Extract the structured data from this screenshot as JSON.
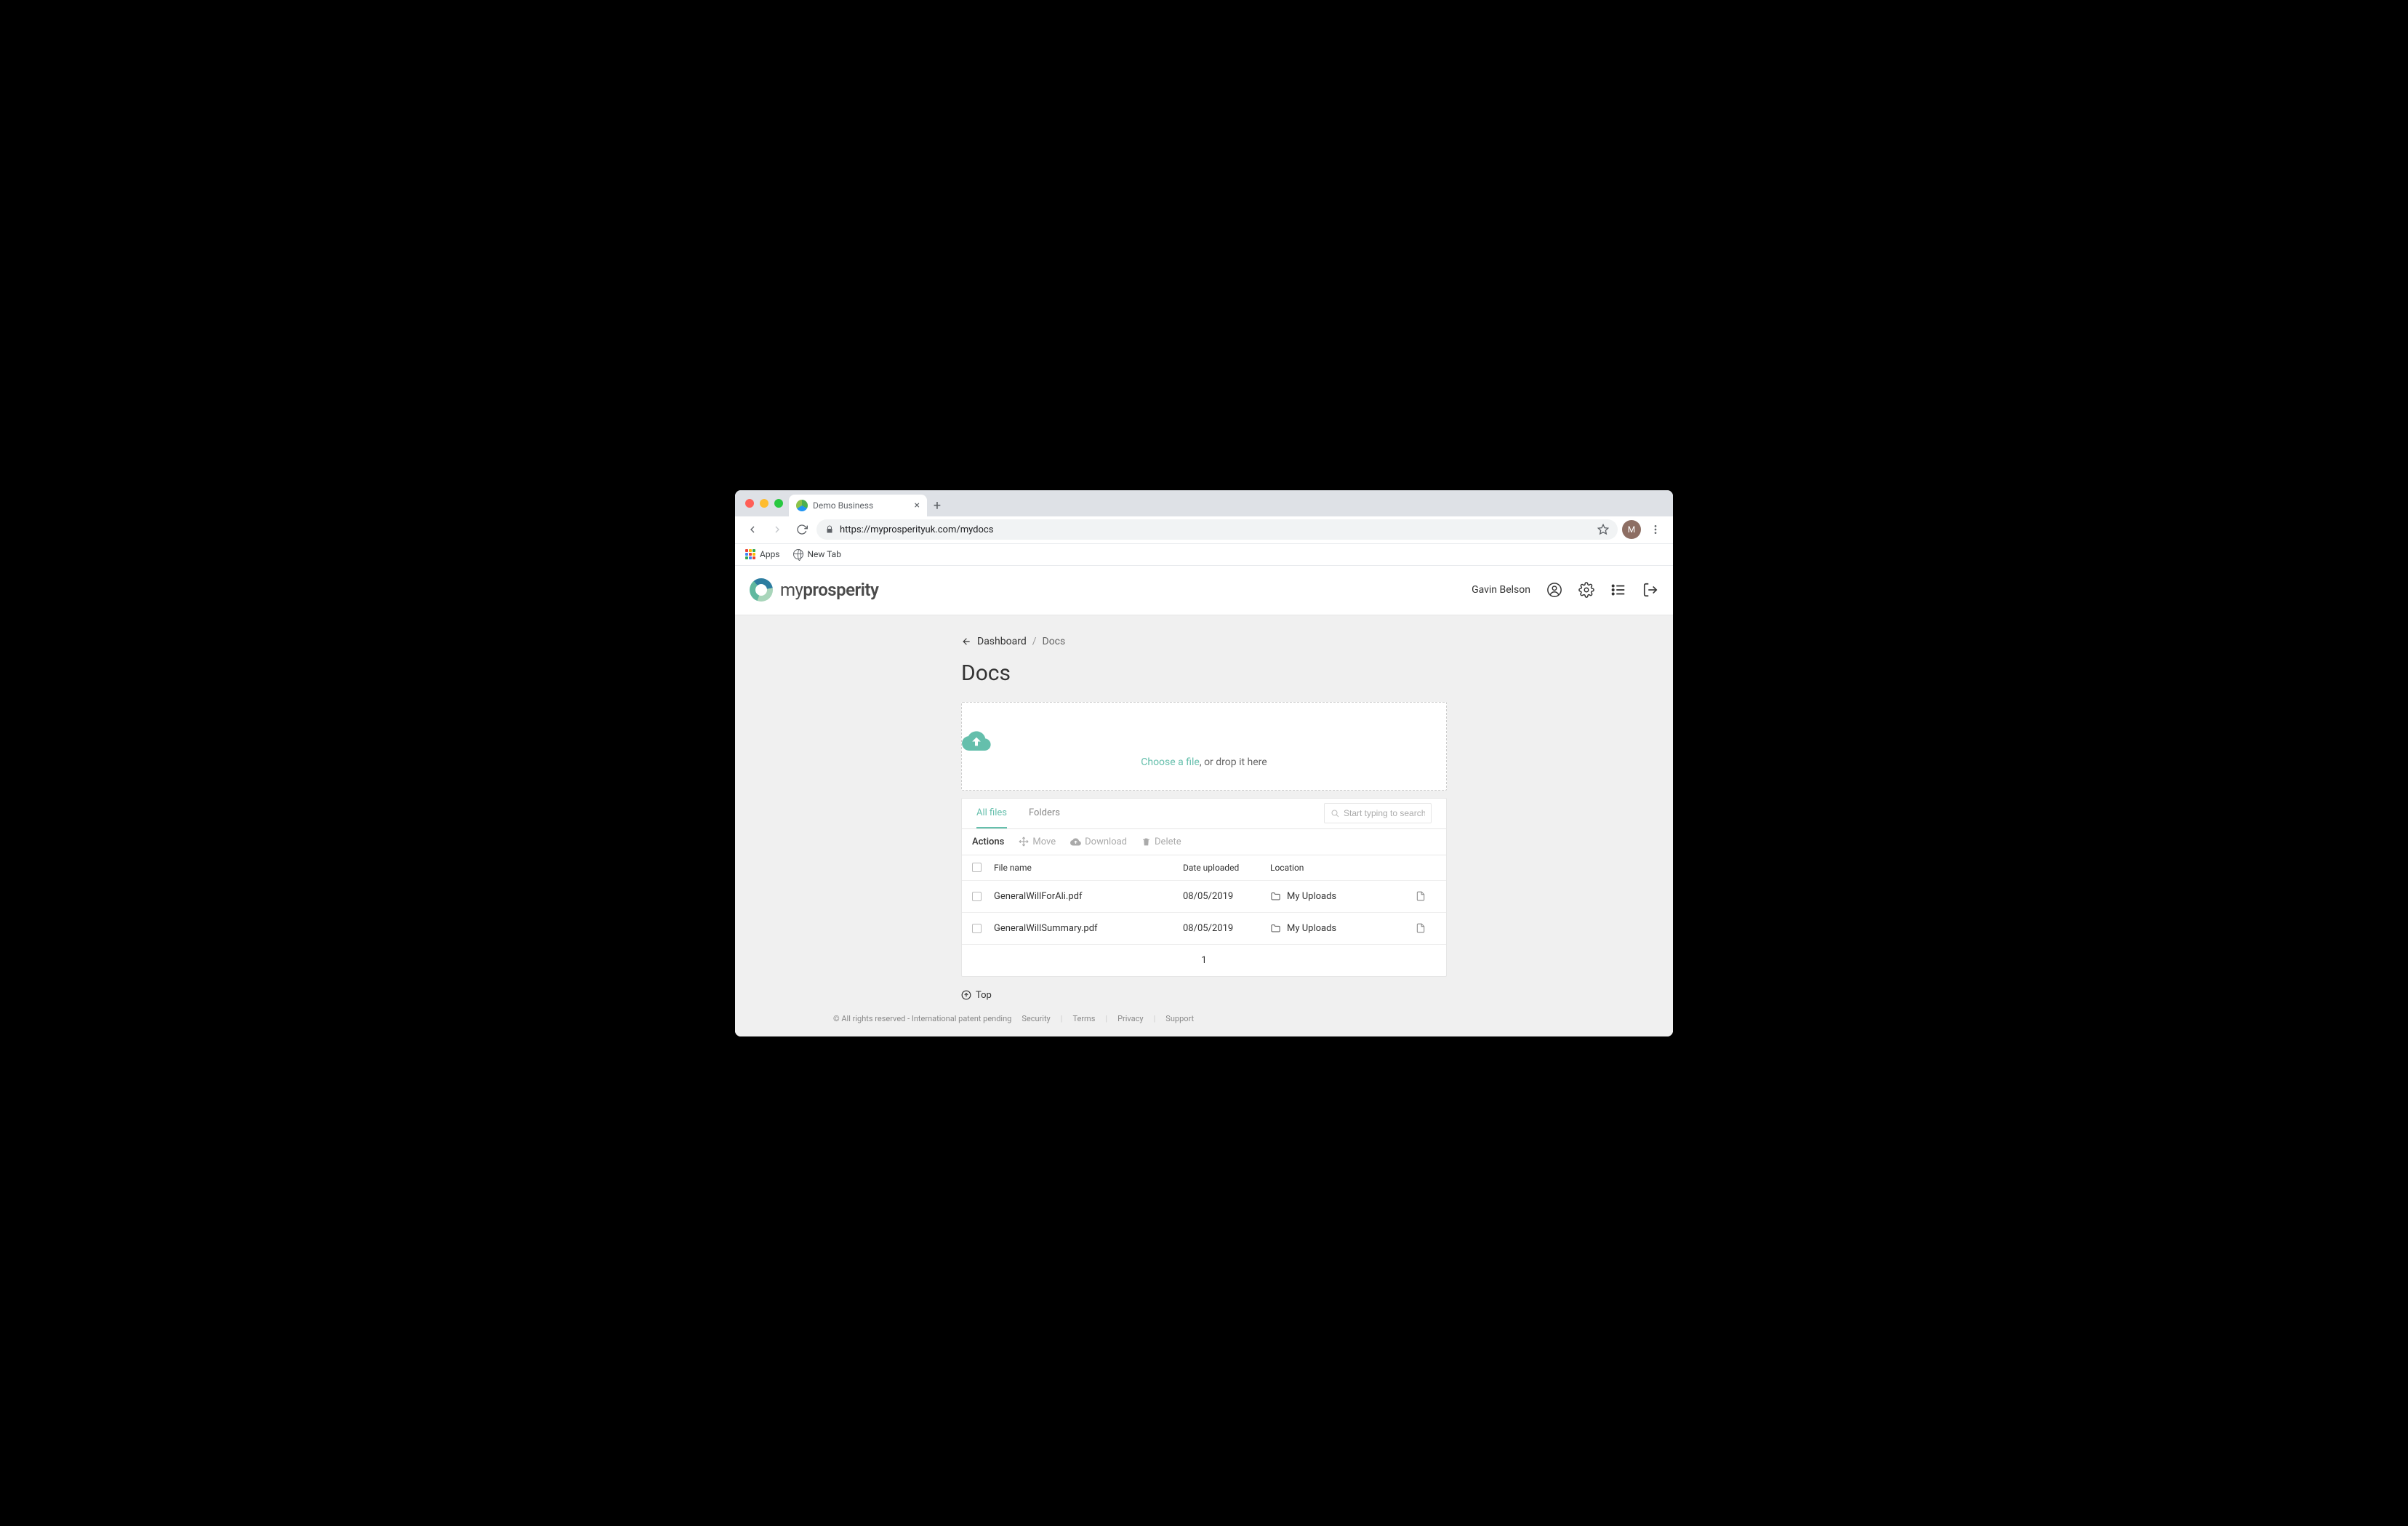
{
  "browser": {
    "tab_title": "Demo Business",
    "url": "https://myprosperityuk.com/mydocs",
    "avatar_initial": "M",
    "bookmarks": {
      "apps": "Apps",
      "new_tab": "New Tab"
    }
  },
  "header": {
    "brand_light": "my",
    "brand_bold": "prosperity",
    "user_name": "Gavin Belson"
  },
  "breadcrumb": {
    "back_label": "Dashboard",
    "current": "Docs"
  },
  "page_title": "Docs",
  "dropzone": {
    "link_text": "Choose a file",
    "rest_text": ", or drop it here"
  },
  "tabs": {
    "all_files": "All files",
    "folders": "Folders"
  },
  "search": {
    "placeholder": "Start typing to search"
  },
  "actions": {
    "label": "Actions",
    "move": "Move",
    "download": "Download",
    "delete": "Delete"
  },
  "table": {
    "headers": {
      "file_name": "File name",
      "date_uploaded": "Date uploaded",
      "location": "Location"
    },
    "rows": [
      {
        "name": "GeneralWillForAli.pdf",
        "date": "08/05/2019",
        "location": "My Uploads"
      },
      {
        "name": "GeneralWillSummary.pdf",
        "date": "08/05/2019",
        "location": "My Uploads"
      }
    ],
    "page": "1"
  },
  "top_link": "Top",
  "footer": {
    "copyright": "© All rights reserved - International patent pending",
    "security": "Security",
    "terms": "Terms",
    "privacy": "Privacy",
    "support": "Support"
  }
}
